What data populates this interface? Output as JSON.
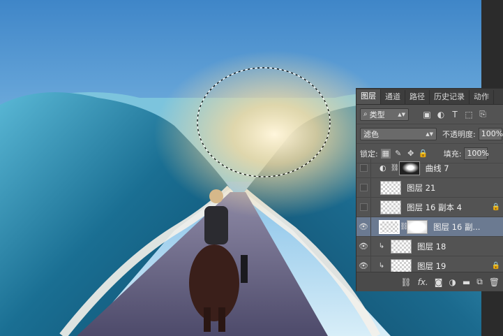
{
  "colors": {
    "sky_top": "#3f86c8",
    "sky_bottom": "#c9e6f5",
    "wave_dark": "#0d4d6e",
    "wave_light": "#3fa6c9",
    "road": "#5d5a7a",
    "panel_bg": "#535353",
    "panel_tab_bg": "#3d3d3d",
    "selected_row": "#6b7a91"
  },
  "panel": {
    "tabs": [
      {
        "label": "图层",
        "active": true
      },
      {
        "label": "通道",
        "active": false
      },
      {
        "label": "路径",
        "active": false
      },
      {
        "label": "历史记录",
        "active": false
      },
      {
        "label": "动作",
        "active": false
      }
    ],
    "filter": {
      "kind_icon": "search-icon",
      "kind_label": "类型",
      "filter_icons": [
        "image-filter-icon",
        "adjustment-filter-icon",
        "type-filter-icon",
        "shape-filter-icon",
        "smart-object-filter-icon"
      ]
    },
    "blend_mode": "滤色",
    "opacity_label": "不透明度:",
    "opacity_value": "100%",
    "lock_label": "锁定:",
    "fill_label": "填充:",
    "fill_value": "100%",
    "layers": [
      {
        "name": "曲线 7",
        "visible": false,
        "type": "adjustment",
        "selected": false,
        "locked": false,
        "clipped": false
      },
      {
        "name": "图层 21",
        "visible": false,
        "type": "pixel",
        "selected": false,
        "locked": false,
        "clipped": false
      },
      {
        "name": "图层 16 副本 4",
        "visible": false,
        "type": "pixel",
        "selected": false,
        "locked": true,
        "clipped": false
      },
      {
        "name": "图层 16 副...",
        "visible": true,
        "type": "masked",
        "selected": true,
        "locked": false,
        "clipped": false
      },
      {
        "name": "图层 18",
        "visible": true,
        "type": "pixel",
        "selected": false,
        "locked": false,
        "clipped": true
      },
      {
        "name": "图层 19",
        "visible": true,
        "type": "pixel",
        "selected": false,
        "locked": true,
        "clipped": true
      }
    ],
    "footer": {
      "fx_label": "fx."
    }
  }
}
